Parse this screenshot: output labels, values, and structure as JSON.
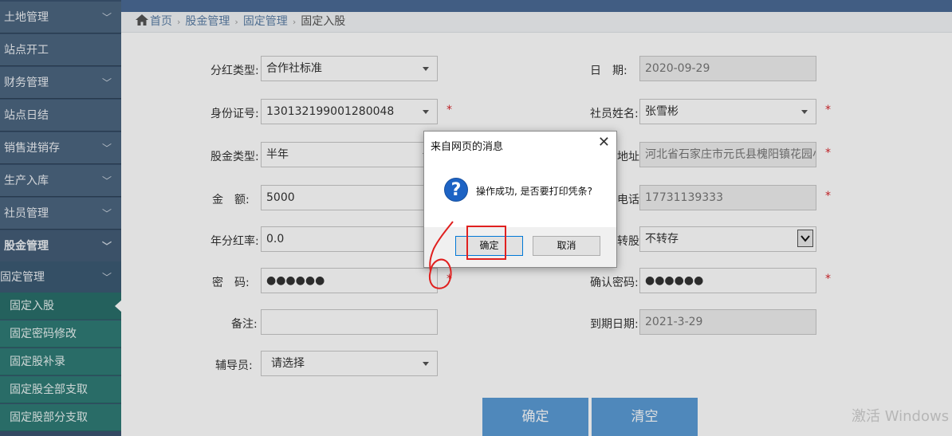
{
  "sidebar": {
    "items": [
      {
        "label": "土地管理"
      },
      {
        "label": "站点开工"
      },
      {
        "label": "财务管理"
      },
      {
        "label": "站点日结"
      },
      {
        "label": "销售进销存"
      },
      {
        "label": "生产入库"
      },
      {
        "label": "社员管理"
      },
      {
        "label": "股金管理"
      },
      {
        "label": "固定管理"
      }
    ],
    "sub_items": [
      {
        "label": "固定入股"
      },
      {
        "label": "固定密码修改"
      },
      {
        "label": "固定股补录"
      },
      {
        "label": "固定股全部支取"
      },
      {
        "label": "固定股部分支取"
      }
    ]
  },
  "breadcrumb": {
    "home": "首页",
    "level1": "股金管理",
    "level2": "固定管理",
    "current": "固定入股"
  },
  "form": {
    "dividend_type_label": "分红类型:",
    "dividend_type_value": "合作社标准",
    "date_label": "日　期:",
    "date_value": "2020-09-29",
    "id_label": "身份证号:",
    "id_value": "130132199001280048",
    "member_name_label": "社员姓名:",
    "member_name_value": "张雪彬",
    "share_type_label": "股金类型:",
    "share_type_value": "半年",
    "address_label": "地址:",
    "address_value": "河北省石家庄市元氏县槐阳镇花园小区",
    "amount_label": "金　额:",
    "amount_value": "5000",
    "phone_label": "电话:",
    "phone_value": "17731139333",
    "annual_rate_label": "年分红率:",
    "annual_rate_value": "0.0",
    "transfer_label": "转股:",
    "transfer_value": "不转存",
    "password_label": "密　码:",
    "password_value": "●●●●●●",
    "confirm_password_label": "确认密码:",
    "confirm_password_value": "●●●●●●",
    "remark_label": "备注:",
    "remark_value": "",
    "due_date_label": "到期日期:",
    "due_date_value": "2021-3-29",
    "counselor_label": "辅导员:",
    "counselor_value": "请选择",
    "required_mark": "*",
    "confirm_button": "确定",
    "clear_button": "清空"
  },
  "dialog": {
    "title": "来自网页的消息",
    "close": "✕",
    "message": "操作成功, 是否要打印凭条?",
    "ok": "确定",
    "cancel": "取消"
  },
  "watermark": "激活 Windows",
  "colors": {
    "sidebar": "#4c6680",
    "submenu": "#2f7c76",
    "button": "#5b9bd5",
    "required": "#d9262c",
    "annotation": "#e0201f",
    "dialog_icon": "#1d63c4"
  }
}
